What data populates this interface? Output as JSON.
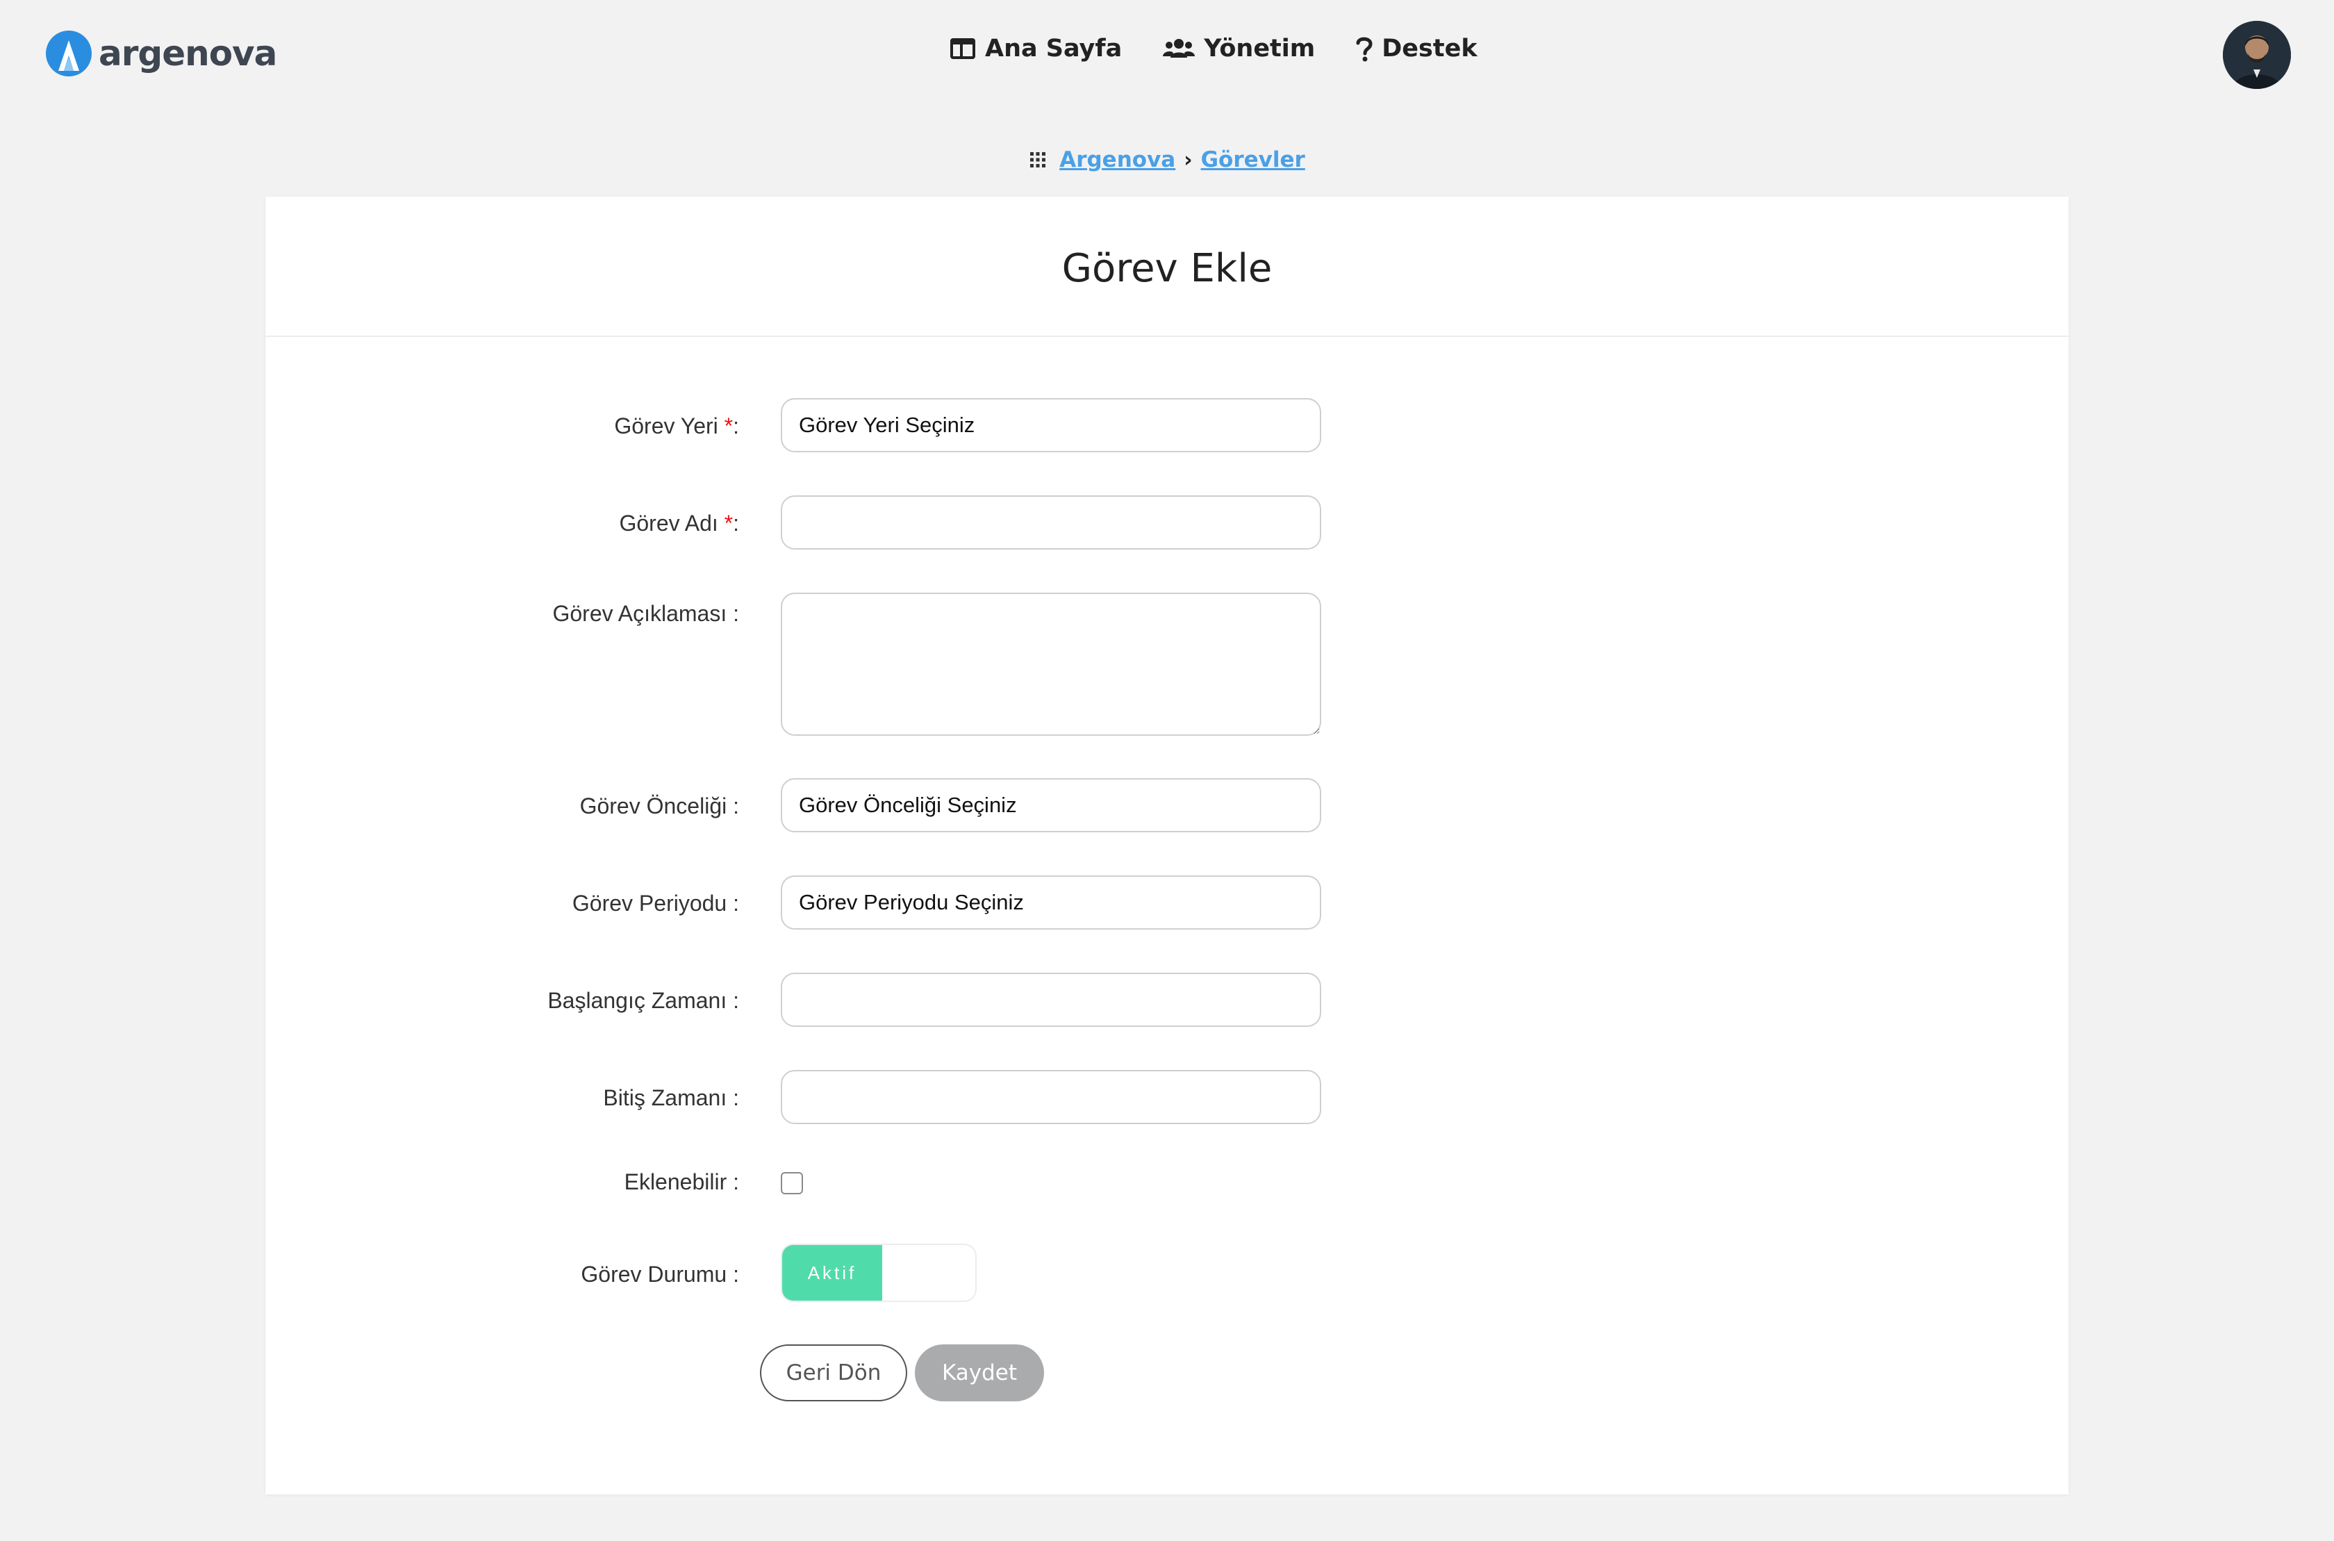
{
  "brand": {
    "name": "argenova",
    "accent": "#2a8de0"
  },
  "nav": {
    "items": [
      {
        "label": "Ana Sayfa",
        "icon": "layout-icon"
      },
      {
        "label": "Yönetim",
        "icon": "users-icon"
      },
      {
        "label": "Destek",
        "icon": "question-icon"
      }
    ]
  },
  "breadcrumb": {
    "icon": "apps-grid-icon",
    "items": [
      "Argenova",
      "Görevler"
    ],
    "separator": "›"
  },
  "page": {
    "title": "Görev Ekle"
  },
  "form": {
    "required_mark": "*",
    "fields": [
      {
        "label": "Görev Yeri ",
        "required": true,
        "suffix": ":",
        "type": "select",
        "value": "Görev Yeri Seçiniz"
      },
      {
        "label": "Görev Adı ",
        "required": true,
        "suffix": ":",
        "type": "text",
        "value": ""
      },
      {
        "label": "Görev Açıklaması :",
        "required": false,
        "type": "textarea",
        "value": ""
      },
      {
        "label": "Görev Önceliği :",
        "required": false,
        "type": "select",
        "value": "Görev Önceliği Seçiniz"
      },
      {
        "label": "Görev Periyodu :",
        "required": false,
        "type": "select",
        "value": "Görev Periyodu Seçiniz"
      },
      {
        "label": "Başlangıç Zamanı :",
        "required": false,
        "type": "text",
        "value": ""
      },
      {
        "label": "Bitiş Zamanı :",
        "required": false,
        "type": "text",
        "value": ""
      },
      {
        "label": "Eklenebilir :",
        "required": false,
        "type": "checkbox",
        "checked": false
      },
      {
        "label": "Görev Durumu :",
        "required": false,
        "type": "toggle",
        "value": "Aktif",
        "on": true,
        "on_color": "#4fdcaa"
      }
    ],
    "buttons": {
      "back": "Geri Dön",
      "save": "Kaydet"
    }
  }
}
